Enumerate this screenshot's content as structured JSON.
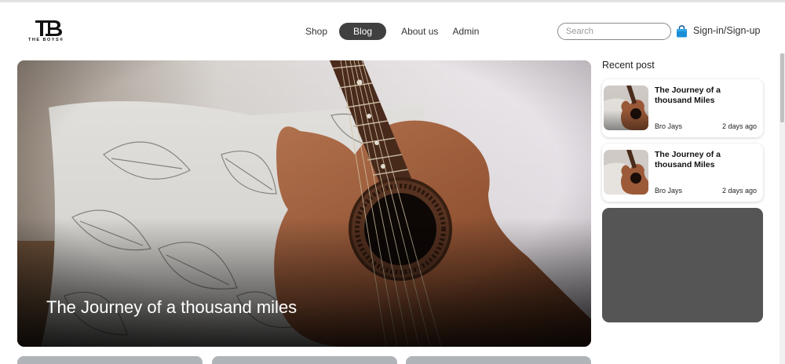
{
  "header": {
    "logo_text": "THE BOYS®",
    "nav": [
      {
        "label": "Shop"
      },
      {
        "label": "Blog"
      },
      {
        "label": "About us"
      },
      {
        "label": "Admin"
      }
    ],
    "search_placeholder": "Search",
    "signin_label": "Sign-in/Sign-up"
  },
  "hero": {
    "title": "The Journey of a thousand miles"
  },
  "sidebar": {
    "title": "Recent post",
    "posts": [
      {
        "title": "The Journey of a thousand Miles",
        "author": "Bro Jays",
        "time": "2 days ago"
      },
      {
        "title": "The Journey of a thousand Miles",
        "author": "Bro Jays",
        "time": "2 days ago"
      }
    ]
  },
  "colors": {
    "active_nav": "#404040",
    "gray_box": "#555555",
    "bag_icon": "#1a8fd6"
  }
}
